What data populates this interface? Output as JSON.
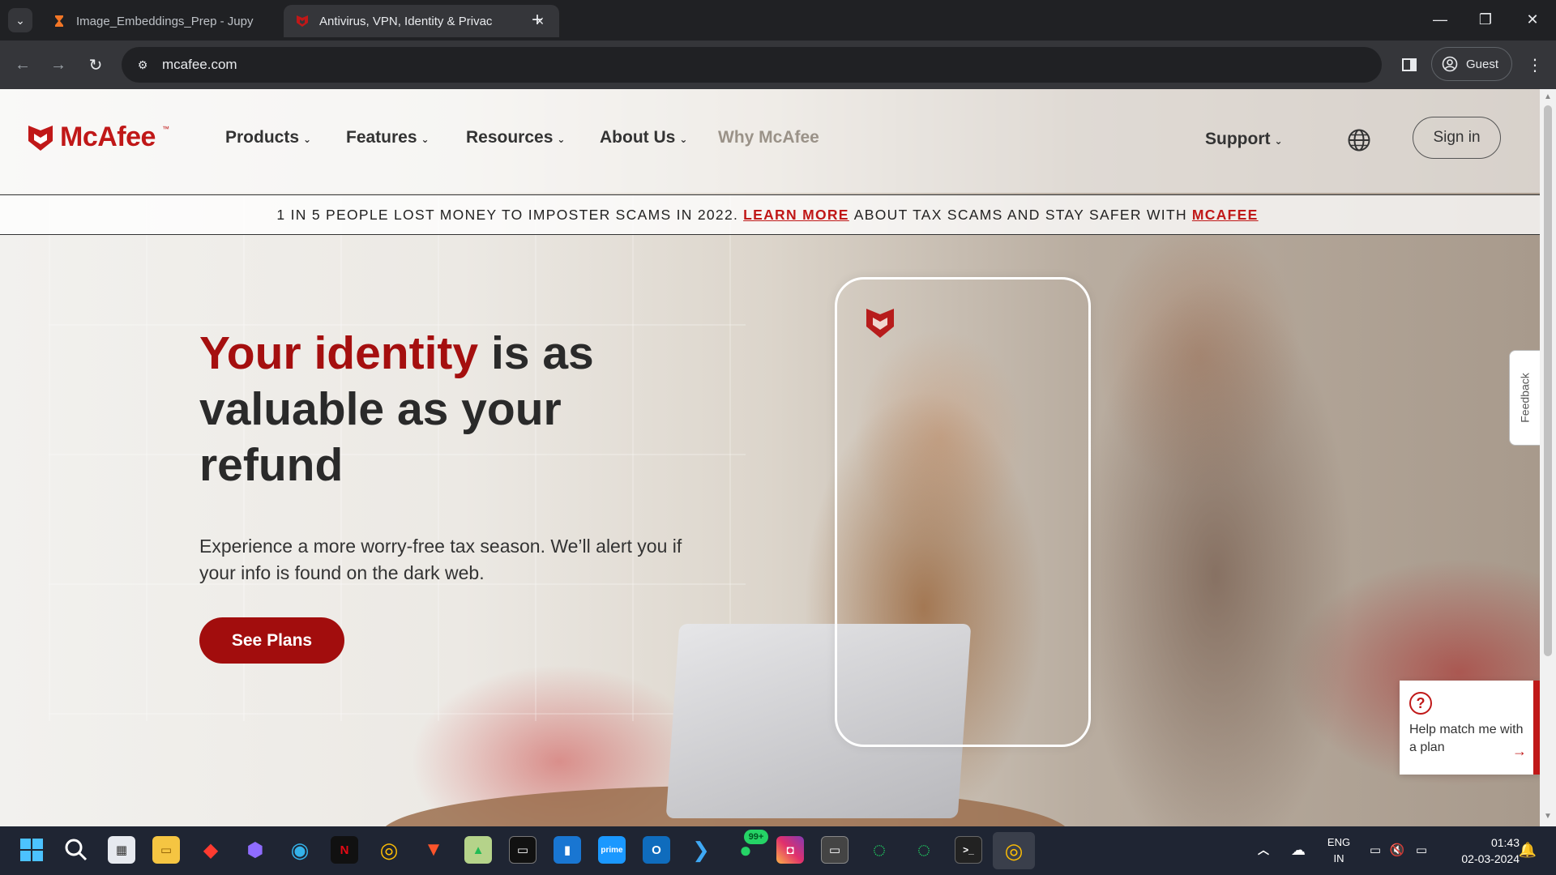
{
  "browser": {
    "tabs": [
      {
        "title": "Image_Embeddings_Prep - Jupy",
        "active": false,
        "favicon": "hourglass-icon"
      },
      {
        "title": "Antivirus, VPN, Identity & Privac",
        "active": true,
        "favicon": "mcafee-shield-icon"
      }
    ],
    "url": "mcafee.com",
    "profile_label": "Guest"
  },
  "site": {
    "logo_text": "McAfee",
    "logo_tm": "™",
    "nav": [
      {
        "label": "Products"
      },
      {
        "label": "Features"
      },
      {
        "label": "Resources"
      },
      {
        "label": "About Us"
      },
      {
        "label": "Why McAfee"
      }
    ],
    "support_label": "Support",
    "signin_label": "Sign in",
    "banner": {
      "text1": "1 IN 5 PEOPLE LOST MONEY TO IMPOSTER SCAMS IN 2022.",
      "link1": "LEARN MORE",
      "text2": "ABOUT TAX SCAMS AND STAY SAFER WITH",
      "link2": "MCAFEE"
    },
    "hero": {
      "title_accent": "Your identity",
      "title_rest": " is as valuable as your refund",
      "subtitle": "Experience a more worry-free tax season. We’ll alert you if your info is found on the dark web.",
      "cta": "See Plans"
    },
    "feedback_label": "Feedback",
    "help_card": {
      "icon": "?",
      "text": "Help match me with a plan",
      "arrow": "→"
    },
    "brand_color": "#C01818"
  },
  "taskbar": {
    "language": "ENG",
    "region": "IN",
    "time": "01:43",
    "date": "02-03-2024",
    "whatsapp_badge": "99+"
  }
}
